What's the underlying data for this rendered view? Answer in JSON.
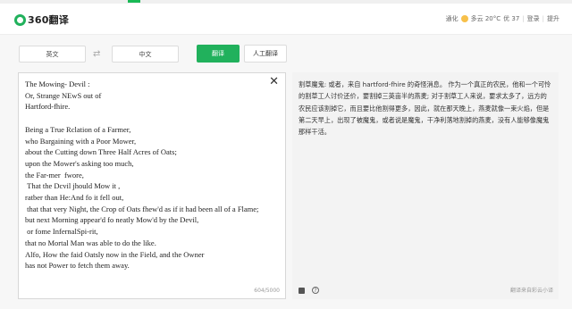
{
  "header": {
    "logo_text": "360翻译",
    "weather": {
      "city": "通化",
      "condition": "多云 20°C",
      "aqi": "优 37",
      "login": "登录",
      "settings": "提升"
    }
  },
  "toolbar": {
    "source_lang": "英文",
    "target_lang": "中文",
    "translate_label": "翻译",
    "human_translate_label": "人工翻译"
  },
  "source": {
    "text": "The Mowing- Devil :\nOr, Strange NEwS out of\nHartford-fhire.\n\nBeing a True Rclation of a Farmer,\nwho Bargaining with a Poor Mower,\nabout the Cutting down Three Half Acres of Oats;\nupon the Mower's asking too much,\nthe Far-mer  fwore,\n That the Dcvil jhould Mow it ,\nratber than He:And fo it fell out,\n that that very Night, the Crop of Oats fhew'd as if it had been all of a Flame;\nbut next Morning appear'd fo neatly Mow'd by the Devil,\n or fome InfernalSpi-rit,\nthat no Mortal Man was able to do the like.\nAlfo, How the faid Oatsly now in the Field, and the Owner\nhas not Power to fetch them away.",
    "char_count": "604/5000"
  },
  "result": {
    "text": "割草魔鬼: 或者，来自 hartford-fhire 的奇怪消息。 作为一个真正的农民，他和一个可怜的割草工人讨价还价，要割掉三英亩半的燕麦; 对于割草工人来说，要求太多了，远方的农民应该割掉它，而且要比他割得更多，因此，就在那天晚上，燕麦就像一束火焰，但是第二天早上，出现了被魔鬼，或者说是魔鬼，干净利落地割掉的燕麦，没有人能够像魔鬼那样干活。",
    "source_note": "翻译来自彩云小译"
  }
}
